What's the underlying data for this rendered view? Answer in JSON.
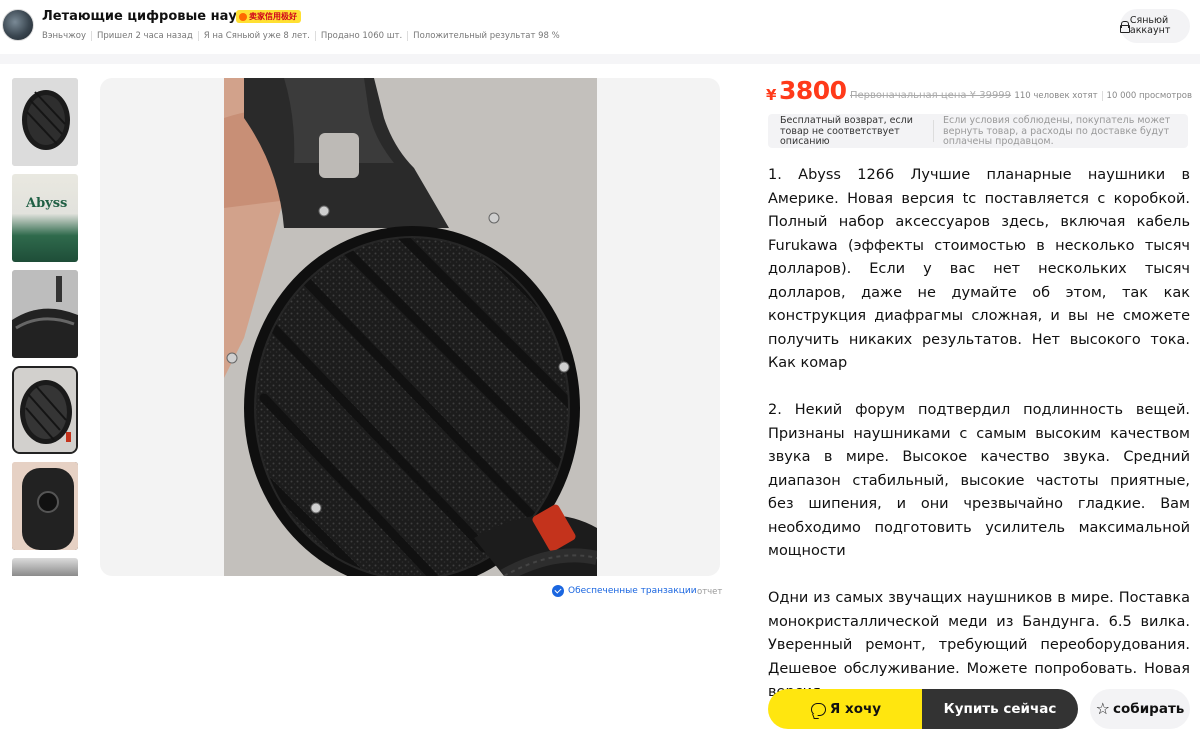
{
  "seller": {
    "name": "Летающие цифровые наушники",
    "badge": "卖家信用极好",
    "location": "Вэньчжоу",
    "last_seen": "Пришел 2 часа назад",
    "member_since": "Я на Сяньюй уже 8 лет.",
    "sold": "Продано 1060 шт.",
    "positive_rate": "Положительный результат 98 %"
  },
  "account": {
    "label": "Сяньюй аккаунт"
  },
  "gallery": {
    "thumbnail_count": 6,
    "active_index": 3,
    "safe_transaction": "Обеспеченные транзакции",
    "report": "отчет"
  },
  "product": {
    "currency": "¥",
    "price": "3800",
    "original_price": "Первоначальная цена ¥ 39999",
    "wants": "110 человек хотят",
    "views": "10 000 просмотров",
    "return_policy_title": "Бесплатный возврат, если товар не соответствует описанию",
    "return_policy_desc": "Если условия соблюдены, покупатель может вернуть товар, а расходы по доставке будут оплачены продавцом.",
    "description": [
      "1. Abyss 1266 Лучшие планарные наушники в Америке. Новая версия tc поставляется с коробкой. Полный набор аксессуаров здесь, включая кабель Furukawa (эффекты стоимостью в несколько тысяч долларов). Если у вас нет нескольких тысяч долларов, даже не думайте об этом, так как конструкция диафрагмы сложная, и вы не сможете получить никаких результатов. Нет высокого тока. Как комар",
      "2. Некий форум подтвердил подлинность вещей. Признаны наушниками с самым высоким качеством звука в мире. Высокое качество звука. Средний диапазон стабильный, высокие частоты приятные, без шипения, и они чрезвычайно гладкие. Вам необходимо подготовить усилитель максимальной мощности",
      "Одни из самых звучащих наушников в мире. Поставка монокристаллической меди из Бандунга. 6.5 вилка. Уверенный ремонт, требующий переоборудования. Дешевое обслуживание. Можете попробовать. Новая версия"
    ]
  },
  "actions": {
    "want": "Я хочу",
    "buy": "Купить сейчас",
    "collect": "собирать"
  },
  "colors": {
    "price": "#ff3a1a",
    "want_button": "#ffe60f",
    "buy_button": "#333333",
    "link": "#1a66e0"
  },
  "icons": {
    "want": "chat-bubble-icon",
    "collect": "star-icon",
    "safe": "shield-check-icon",
    "account": "lock-icon"
  }
}
